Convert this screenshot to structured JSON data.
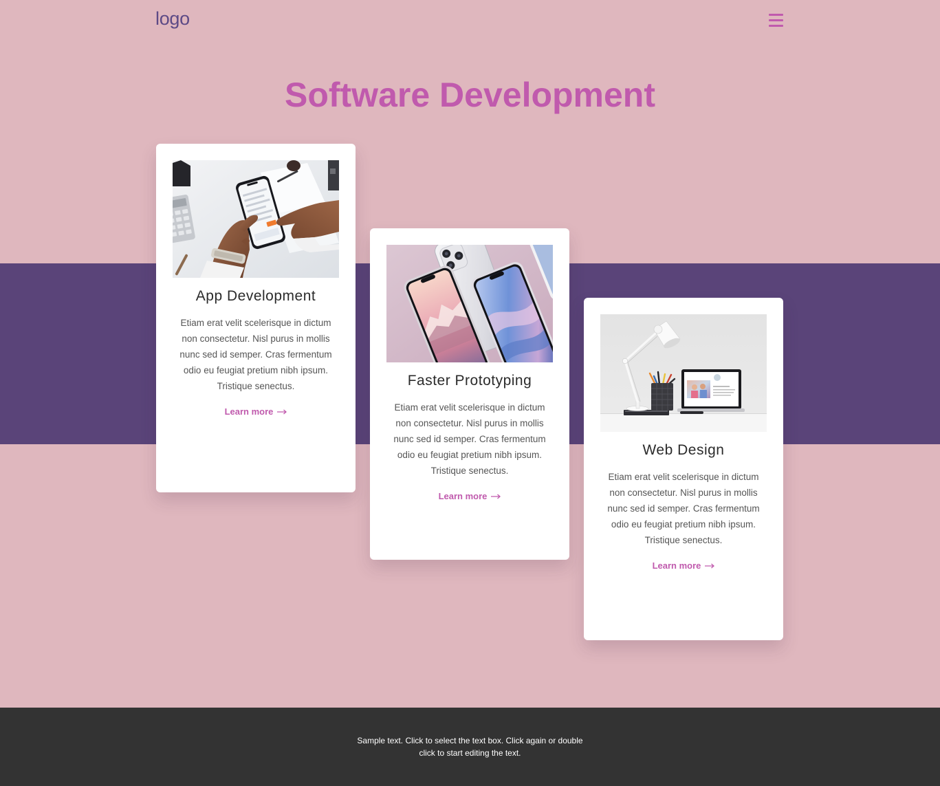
{
  "header": {
    "logo": "logo",
    "menu_icon": "hamburger-menu-icon"
  },
  "hero": {
    "title": "Software Development"
  },
  "cards": [
    {
      "title": "App Development",
      "text": "Etiam erat velit scelerisque in dictum non consectetur. Nisl purus in mollis nunc sed id semper. Cras fermentum odio eu feugiat pretium nibh ipsum. Tristique senectus.",
      "link_label": "Learn more",
      "link_icon": "arrow-right-icon"
    },
    {
      "title": "Faster Prototyping",
      "text": "Etiam erat velit scelerisque in dictum non consectetur. Nisl purus in mollis nunc sed id semper. Cras fermentum odio eu feugiat pretium nibh ipsum. Tristique senectus.",
      "link_label": "Learn more",
      "link_icon": "arrow-right-icon"
    },
    {
      "title": "Web Design",
      "text": "Etiam erat velit scelerisque in dictum non consectetur. Nisl purus in mollis nunc sed id semper. Cras fermentum odio eu feugiat pretium nibh ipsum. Tristique senectus.",
      "link_label": "Learn more",
      "link_icon": "arrow-right-icon"
    }
  ],
  "footer": {
    "text": "Sample text. Click to select the text box. Click again or double click to start editing the text."
  },
  "colors": {
    "background": "#dfb7be",
    "band": "#5a4479",
    "accent": "#c05aad",
    "logo": "#5d4a86",
    "footer": "#333333",
    "card": "#ffffff"
  }
}
